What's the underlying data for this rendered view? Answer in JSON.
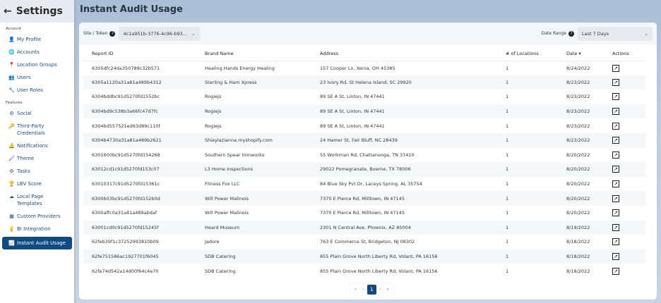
{
  "sidebar": {
    "title": "Settings",
    "sections": [
      {
        "label": "Account",
        "items": [
          {
            "icon": "user-icon",
            "glyph": "👤",
            "label": "My Profile"
          },
          {
            "icon": "globe-icon",
            "glyph": "🌐",
            "label": "Accounts"
          },
          {
            "icon": "map-pin-icon",
            "glyph": "📍",
            "label": "Location Groups"
          },
          {
            "icon": "users-icon",
            "glyph": "👥",
            "label": "Users"
          },
          {
            "icon": "wrench-icon",
            "glyph": "🔧",
            "label": "User Roles"
          }
        ]
      },
      {
        "label": "Features",
        "items": [
          {
            "icon": "gear-icon",
            "glyph": "⚙",
            "label": "Social"
          },
          {
            "icon": "key-icon",
            "glyph": "🔑",
            "label": "Third-Party Credentials"
          },
          {
            "icon": "bell-icon",
            "glyph": "🔔",
            "label": "Notifications"
          },
          {
            "icon": "brush-icon",
            "glyph": "🖌",
            "label": "Theme"
          },
          {
            "icon": "gear-icon",
            "glyph": "⚙",
            "label": "Tasks"
          },
          {
            "icon": "trophy-icon",
            "glyph": "🏆",
            "label": "LBV Score"
          },
          {
            "icon": "cloud-icon",
            "glyph": "☁",
            "label": "Local Page Templates"
          },
          {
            "icon": "table-icon",
            "glyph": "▦",
            "label": "Custom Providers"
          },
          {
            "icon": "lightbulb-icon",
            "glyph": "💡",
            "label": "BI Integration"
          },
          {
            "icon": "chart-icon",
            "glyph": "📈",
            "label": "Instant Audit Usage",
            "active": true
          }
        ]
      }
    ]
  },
  "page": {
    "title": "Instant Audit Usage"
  },
  "filters": {
    "site_label": "Site / Token",
    "site_value": "4c1a951b-3776-4c96-b93...",
    "date_label": "Date Range",
    "date_value": "Last 7 Days"
  },
  "table": {
    "columns": [
      "Report ID",
      "Brand Name",
      "Address",
      "# of Locations",
      "Date",
      "Actions"
    ],
    "sort_indicator": "▾",
    "rows": [
      [
        "6305dfc24da350789c32b571",
        "Healing Hands Energy Healing",
        "157 Cooper Ln, Xenia, OH 45385",
        "1",
        "8/24/2022"
      ],
      [
        "6305a1120a31a81a489b4312",
        "Sterling & Ham Xpress",
        "23 Ivory Rd, St Helena Island, SC 29920",
        "1",
        "8/23/2022"
      ],
      [
        "6304bddbc91d5270fd1552bc",
        "Rogiejs",
        "89 SE A St, Linton, IN 47441",
        "1",
        "8/23/2022"
      ],
      [
        "6304bd9c538b3a66fc47d7fc",
        "Rogiejs",
        "89 SE A St, Linton, IN 47441",
        "1",
        "8/23/2022"
      ],
      [
        "6304bd557521ed63d89c110f",
        "Rogiejs",
        "89 SE A St, Linton, IN 47441",
        "1",
        "8/23/2022"
      ],
      [
        "6304b4730a31a81a489b2621",
        "Shiaylazianna.myshopify.com",
        "24 Hamer St, Fair Bluff, NC 28439",
        "1",
        "8/23/2022"
      ],
      [
        "6301600bc91d5270fd154268",
        "Southern Spear Ironworks",
        "55 Workman Rd, Chattanooga, TN 37410",
        "1",
        "8/20/2022"
      ],
      [
        "63012cd1c91d5270fd153c07",
        "L3 Home Inspections",
        "29022 Pomegranate, Boerne, TX 78006",
        "1",
        "8/20/2022"
      ],
      [
        "63010317c91d5270fd15361c",
        "Fitness Fox LLC",
        "84 Blue Sky Pvt Dr, Laceys Spring, AL 35754",
        "1",
        "8/20/2022"
      ],
      [
        "6300b03bc91d5270fd152b0d",
        "Will Power Malinois",
        "7370 E Pierce Rd, Milltown, IN 47145",
        "1",
        "8/20/2022"
      ],
      [
        "6300affc0a31a81a489abdaf",
        "Will Power Malinois",
        "7370 E Pierce Rd, Milltown, IN 47145",
        "1",
        "8/20/2022"
      ],
      [
        "63001cd0c91d5270fd15245f",
        "Heard Museum",
        "2301 N Central Ave, Phoenix, AZ 85004",
        "1",
        "8/19/2022"
      ],
      [
        "62feb39f1c37252993810b09",
        "Jadore",
        "763 E Commerce St, Bridgeton, NJ 08302",
        "1",
        "8/18/2022"
      ],
      [
        "62fe751586ac1927701f6045",
        "SDB Catering",
        "855 Plain Grove North Liberty Rd, Volant, PA 16156",
        "1",
        "8/18/2022"
      ],
      [
        "62fe74d542a14d00f64c4e70",
        "SDB Catering",
        "855 Plain Grove North Liberty Rd, Volant, PA 16156",
        "1",
        "8/18/2022"
      ]
    ]
  },
  "pagination": {
    "first": "«",
    "prev": "‹",
    "current": "1",
    "next": "›",
    "last": "»"
  },
  "colors": {
    "accent": "#0f4a80"
  }
}
